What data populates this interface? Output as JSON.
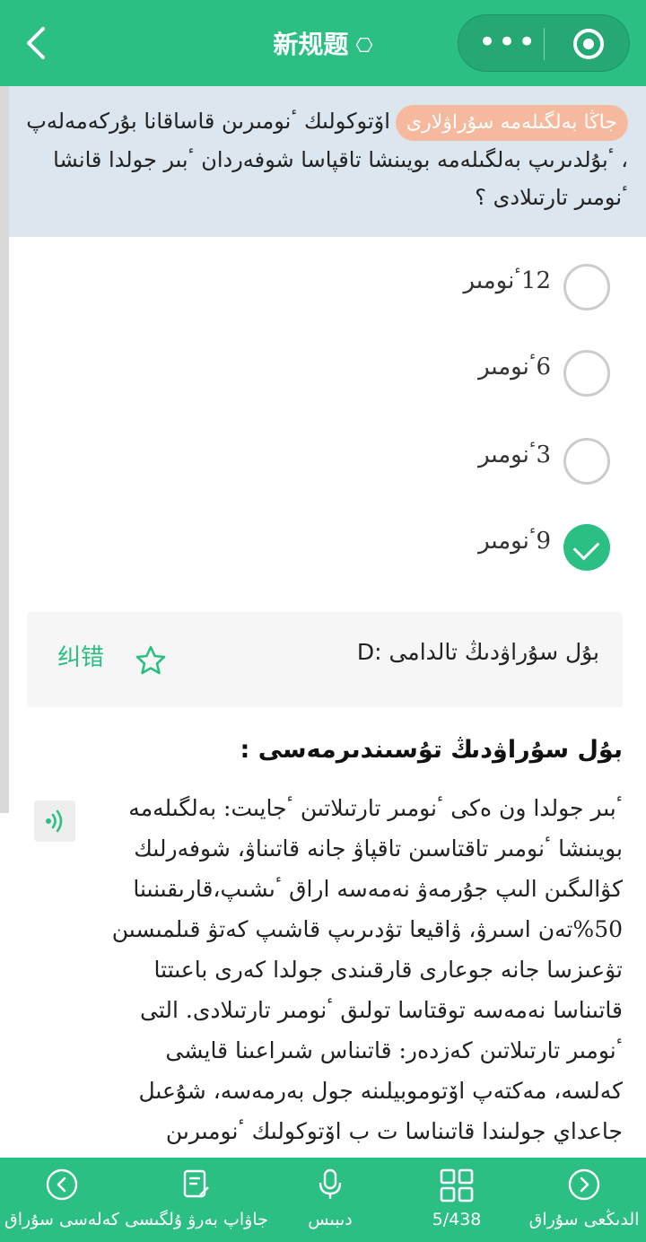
{
  "header": {
    "title": "新规题",
    "title_icon": "hexagon-gear-icon",
    "back_icon": "chevron-left-icon",
    "more_icon": "more-dots-icon",
    "close_icon": "target-icon"
  },
  "question": {
    "badge": "جاڭا بەلگىلەمە سۇراۋلارى",
    "text": "اۆتوكولىك ٴنومىرىن قاساقانا بۇركەمەلەپ ، ٴبۇلدىرىپ بەلگىلەمە بويىنشا تاقپاسا شوفەردان ٴبىر جولدا قانشا ٴنومىر تارتىلادى ؟"
  },
  "options": [
    {
      "label": "12ٴنومىر",
      "selected": false
    },
    {
      "label": "6ٴنومىر",
      "selected": false
    },
    {
      "label": "3ٴنومىر",
      "selected": false
    },
    {
      "label": "9ٴنومىر",
      "selected": true
    }
  ],
  "answer": {
    "correction": "纠错",
    "star_icon": "star-outline-icon",
    "text": "بۇل سۇراۋدىڭ تالدامى :D"
  },
  "explanation": {
    "title": "بۇل سۇراۋدىڭ تۇسىندىرمەسى :",
    "audio_icon": "audio-wave-icon",
    "text": "ٴبىر جولدا ون ەكى ٴنومىر تارتىلاتىن ٴجايىت: بەلگىلەمە بويىنشا ٴنومىر تاقتاسىن تاقپاۋ جانە قاتىناۋ، شوفەرلىك كۋالىگىن الىپ جۇرمەۋ نەمەسە اراق ٴىشىپ،قارىقىنىنا 50%تەن اسىرۋ، ۋاقيعا تۋدىرىپ قاشىپ كەتۋ قىلمىسىن تۋعىزسا جانە جوعارى قارقىندى جولدا كەرى باعىتتا قاتىناسا نەمەسە توقتاسا تولىق ٴنومىر تارتىلادى. التى ٴنومىر تارتىلاتىن كەزدەر: قاتىناس شىراعىنا قايشى كەلسە، مەكتەپ اۆتوموبيلىنە جول بەرمەسە، شۇعىل جاعداي جولىندا قاتىناسا ت ب اۆتوكولىك ٴنومىرىن قاساقانا بۇركەمەلەسە ٴبىر جولدا توعىز ٴنومىر تارتىلادى"
  },
  "bottom_nav": [
    {
      "label": "كەلەسى سۇراق",
      "icon": "chevron-left-circle-icon"
    },
    {
      "label": "جاۋاپ بەرۋ ۇلگىسى",
      "icon": "document-edit-icon"
    },
    {
      "label": "دىبىس",
      "icon": "microphone-icon"
    },
    {
      "label": "5/438",
      "icon": "grid-icon"
    },
    {
      "label": "الدىڭعى سۇراق",
      "icon": "chevron-right-circle-icon"
    }
  ],
  "colors": {
    "accent": "#2bbf84",
    "question_bg": "#dbe6ee",
    "badge": "#f7b99d"
  }
}
